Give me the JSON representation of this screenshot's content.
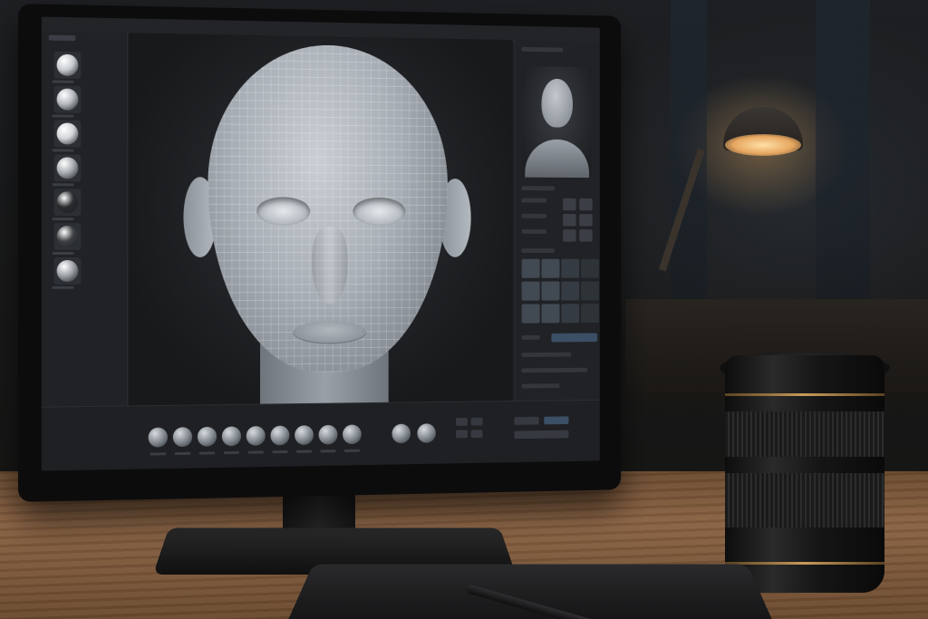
{
  "app": {
    "title": "",
    "viewport_label": ""
  },
  "left_panel": {
    "materials": [
      {
        "name": "mat-1",
        "color": "#c8ccd0"
      },
      {
        "name": "mat-2",
        "color": "#b5b9be"
      },
      {
        "name": "mat-3",
        "color": "#d2d5d8"
      },
      {
        "name": "mat-4",
        "color": "#a9adb2"
      },
      {
        "name": "mat-5",
        "color": "#2a2c2f"
      },
      {
        "name": "mat-6",
        "color": "#3c3f43"
      },
      {
        "name": "mat-7",
        "color": "#9ea3a8"
      }
    ]
  },
  "bottom_bar": {
    "tab_left": "",
    "tab_center": "",
    "sphere_count": 9
  },
  "colors": {
    "accent": "#3b4f66",
    "panel": "#202226",
    "desk": "#8a6242"
  }
}
